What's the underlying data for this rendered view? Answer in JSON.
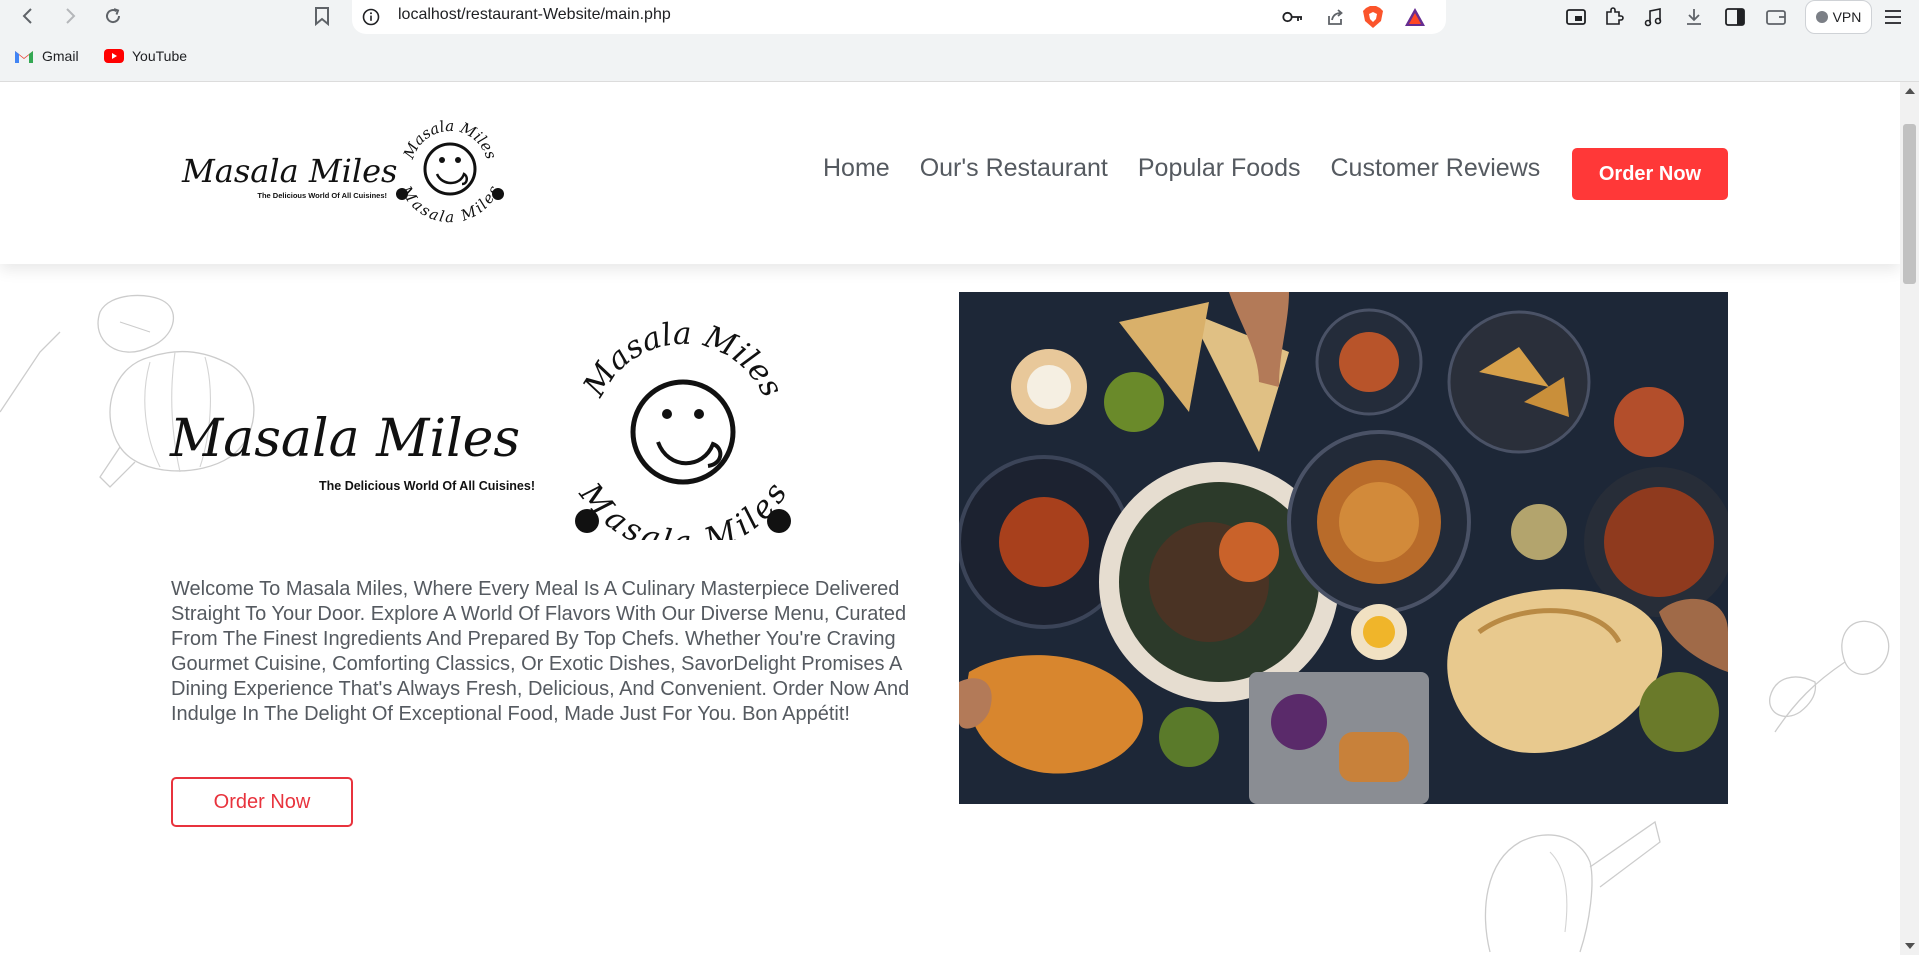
{
  "browser": {
    "url": "localhost/restaurant-Website/main.php",
    "vpn_label": "VPN",
    "bookmarks": [
      {
        "label": "Gmail",
        "icon": "gmail-icon"
      },
      {
        "label": "YouTube",
        "icon": "youtube-icon"
      }
    ]
  },
  "site": {
    "brand": {
      "name": "Masala Miles",
      "tagline": "The Delicious World Of All Cuisines!",
      "emblem_text": "Masala Miles"
    },
    "nav": [
      {
        "label": "Home"
      },
      {
        "label": "Our's Restaurant"
      },
      {
        "label": "Popular Foods"
      },
      {
        "label": "Customer Reviews"
      }
    ],
    "order_button_label": "Order Now",
    "hero": {
      "welcome_text": "Welcome To Masala Miles, Where Every Meal Is A Culinary Masterpiece Delivered Straight To Your Door. Explore A World Of Flavors With Our Diverse Menu, Curated From The Finest Ingredients And Prepared By Top Chefs. Whether You're Craving Gourmet Cuisine, Comforting Classics, Or Exotic Dishes, SavorDelight Promises A Dining Experience That's Always Fresh, Delicious, And Convenient. Order Now And Indulge In The Delight Of Exceptional Food, Made Just For You. Bon Appétit!",
      "cta_label": "Order Now"
    }
  },
  "colors": {
    "accent": "#ff3838",
    "nav_text": "#555a60",
    "chrome_bg": "#f1f3f4"
  }
}
